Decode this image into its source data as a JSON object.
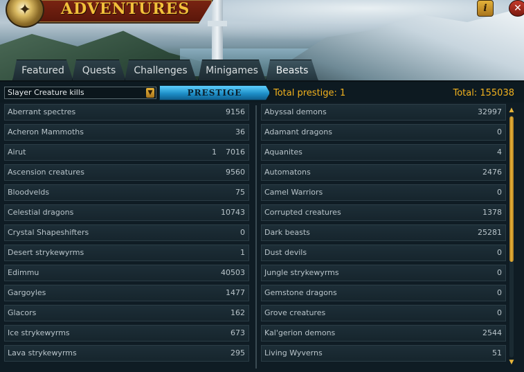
{
  "window": {
    "title": "ADVENTURES",
    "icons": {
      "logo": "compass-icon",
      "info": "info-icon",
      "close": "close-icon"
    }
  },
  "tabs": [
    {
      "label": "Featured",
      "active": false
    },
    {
      "label": "Quests",
      "active": false
    },
    {
      "label": "Challenges",
      "active": false
    },
    {
      "label": "Minigames",
      "active": false
    },
    {
      "label": "Beasts",
      "active": true
    }
  ],
  "controls": {
    "filter_value": "Slayer Creature kills",
    "prestige_label": "PRESTIGE",
    "total_prestige": "Total prestige: 1",
    "total_kills": "Total: 155038"
  },
  "beasts_left": [
    {
      "name": "Aberrant spectres",
      "count": "9156"
    },
    {
      "name": "Acheron Mammoths",
      "count": "36"
    },
    {
      "name": "Airut",
      "count": "7016",
      "prestige": "1"
    },
    {
      "name": "Ascension creatures",
      "count": "9560"
    },
    {
      "name": "Bloodvelds",
      "count": "75"
    },
    {
      "name": "Celestial dragons",
      "count": "10743"
    },
    {
      "name": "Crystal Shapeshifters",
      "count": "0"
    },
    {
      "name": "Desert strykewyrms",
      "count": "1"
    },
    {
      "name": "Edimmu",
      "count": "40503"
    },
    {
      "name": "Gargoyles",
      "count": "1477"
    },
    {
      "name": "Glacors",
      "count": "162"
    },
    {
      "name": "Ice strykewyrms",
      "count": "673"
    },
    {
      "name": "Lava strykewyrms",
      "count": "295"
    }
  ],
  "beasts_right": [
    {
      "name": "Abyssal demons",
      "count": "32997"
    },
    {
      "name": "Adamant dragons",
      "count": "0"
    },
    {
      "name": "Aquanites",
      "count": "4"
    },
    {
      "name": "Automatons",
      "count": "2476"
    },
    {
      "name": "Camel Warriors",
      "count": "0"
    },
    {
      "name": "Corrupted creatures",
      "count": "1378"
    },
    {
      "name": "Dark beasts",
      "count": "25281"
    },
    {
      "name": "Dust devils",
      "count": "0"
    },
    {
      "name": "Jungle strykewyrms",
      "count": "0"
    },
    {
      "name": "Gemstone dragons",
      "count": "0"
    },
    {
      "name": "Grove creatures",
      "count": "0"
    },
    {
      "name": "Kal'gerion demons",
      "count": "2544"
    },
    {
      "name": "Living Wyverns",
      "count": "51"
    }
  ],
  "colors": {
    "accent": "#f2b21e",
    "prestige_button": "#1e8fc8",
    "title": "#f2c03a"
  }
}
